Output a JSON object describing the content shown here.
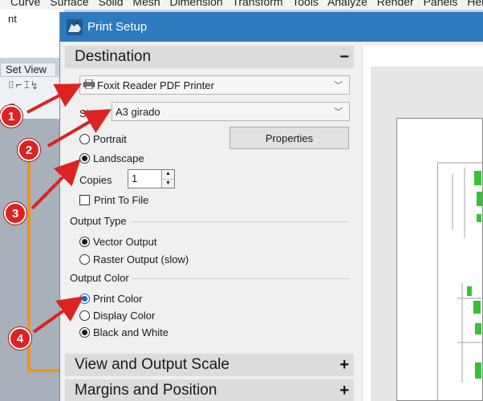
{
  "app": {
    "menu_items": [
      "Curve",
      "Surface",
      "Solid",
      "Mesh",
      "Dimension",
      "Transform",
      "Tools",
      "Analyze",
      "Render",
      "Panels",
      "Help"
    ],
    "command_text": "nt",
    "viewport_tab": "Set View"
  },
  "dialog": {
    "title": "Print Setup",
    "destination": {
      "header": "Destination",
      "toggle": "−",
      "printer": "Foxit Reader PDF Printer",
      "size_label": "Size",
      "size_value": "A3 girado",
      "portrait": "Portrait",
      "landscape": "Landscape",
      "properties_button": "Properties",
      "copies_label": "Copies",
      "copies_value": "1",
      "print_to_file": "Print To File"
    },
    "output_type": {
      "title": "Output Type",
      "vector": "Vector Output",
      "raster": "Raster Output (slow)"
    },
    "output_color": {
      "title": "Output Color",
      "print_color": "Print Color",
      "display_color": "Display Color",
      "black_white": "Black and White"
    },
    "view_scale": {
      "header": "View and Output Scale",
      "toggle": "+"
    },
    "margins": {
      "header": "Margins and Position",
      "toggle": "+"
    }
  },
  "annotations": {
    "callouts": [
      "1",
      "2",
      "3",
      "4"
    ],
    "color": "#dd2222"
  },
  "colors": {
    "titlebar": "#2d7bbf",
    "accent_orange": "#f0931d"
  }
}
